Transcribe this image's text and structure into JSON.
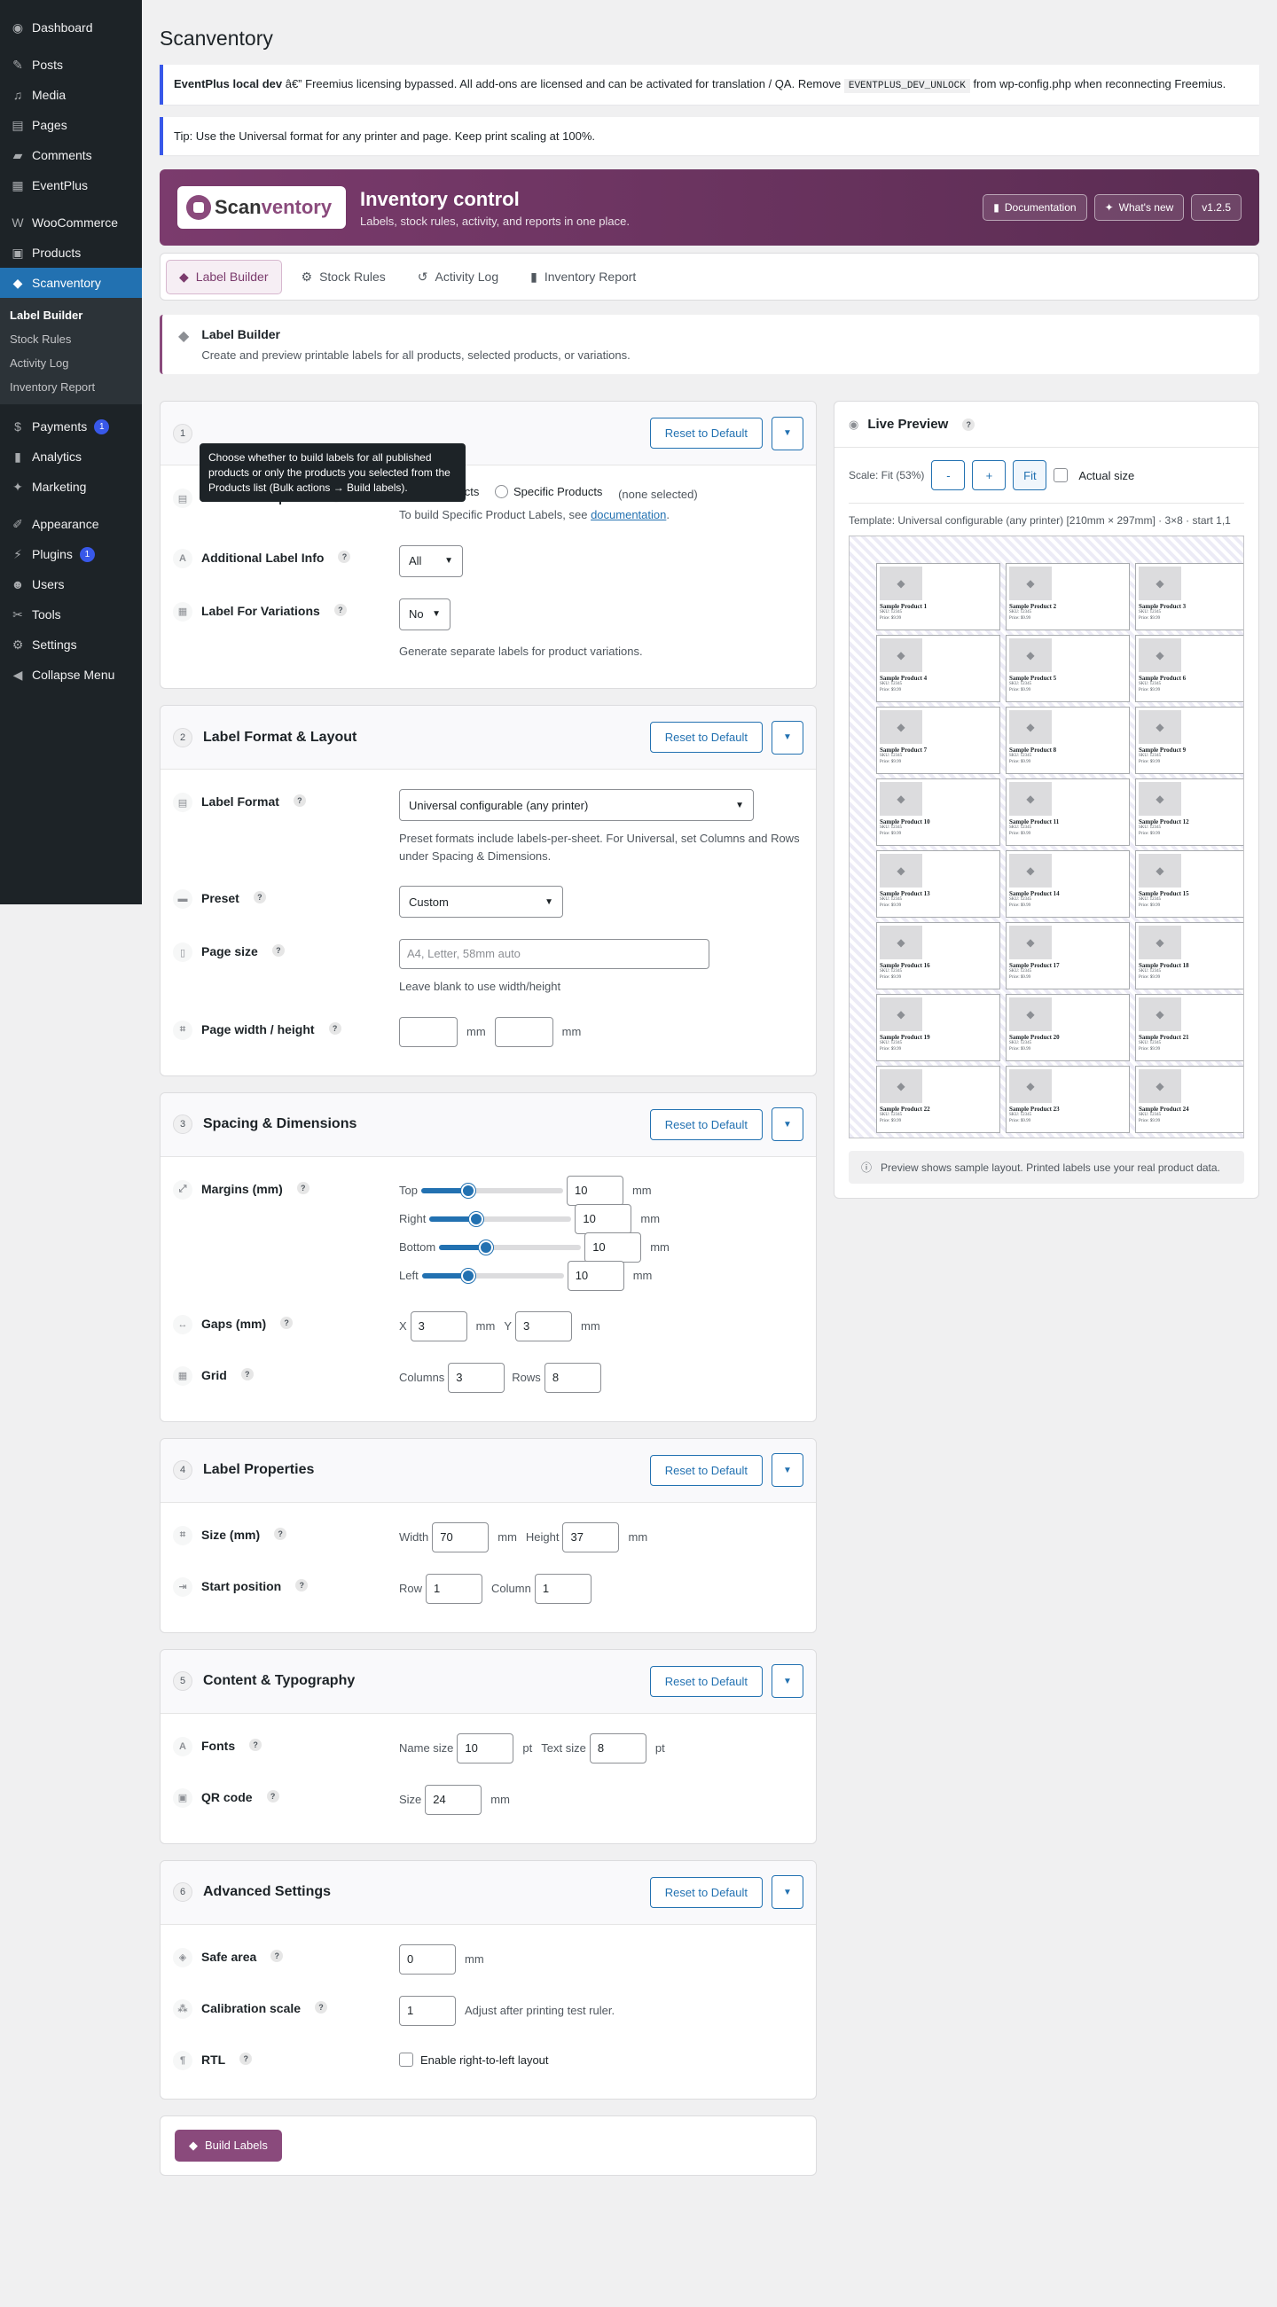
{
  "sidebar": {
    "items": [
      {
        "label": "Dashboard",
        "icon": "dashboard-icon"
      },
      {
        "label": "Posts",
        "icon": "pin-icon"
      },
      {
        "label": "Media",
        "icon": "media-icon"
      },
      {
        "label": "Pages",
        "icon": "pages-icon"
      },
      {
        "label": "Comments",
        "icon": "comment-icon"
      },
      {
        "label": "EventPlus",
        "icon": "calendar-icon"
      },
      {
        "label": "WooCommerce",
        "icon": "woo-icon"
      },
      {
        "label": "Products",
        "icon": "box-icon"
      },
      {
        "label": "Scanventory",
        "icon": "tag-icon"
      },
      {
        "label": "Payments",
        "icon": "dollar-icon",
        "badge": "1"
      },
      {
        "label": "Analytics",
        "icon": "bar-chart-icon"
      },
      {
        "label": "Marketing",
        "icon": "megaphone-icon"
      },
      {
        "label": "Appearance",
        "icon": "brush-icon"
      },
      {
        "label": "Plugins",
        "icon": "plug-icon",
        "badge": "1"
      },
      {
        "label": "Users",
        "icon": "user-icon"
      },
      {
        "label": "Tools",
        "icon": "wrench-icon"
      },
      {
        "label": "Settings",
        "icon": "settings-icon"
      },
      {
        "label": "Collapse Menu",
        "icon": "collapse-icon"
      }
    ],
    "submenu": [
      "Label Builder",
      "Stock Rules",
      "Activity Log",
      "Inventory Report"
    ]
  },
  "page_title": "Scanventory",
  "notice": {
    "strong": "EventPlus local dev",
    "text1": " â€” Freemius licensing bypassed. All add-ons are licensed and can be activated for translation / QA. Remove ",
    "code": "EVENTPLUS_DEV_UNLOCK",
    "text2": " from wp-config.php when reconnecting Freemius."
  },
  "tip": "Tip: Use the Universal format for any printer and page. Keep print scaling at 100%.",
  "banner": {
    "logo_a": "Scan",
    "logo_b": "ventory",
    "title": "Inventory control",
    "subtitle": "Labels, stock rules, activity, and reports in one place.",
    "doc_btn": "Documentation",
    "new_btn": "What's new",
    "version": "v1.2.5"
  },
  "tabs": [
    "Label Builder",
    "Stock Rules",
    "Activity Log",
    "Inventory Report"
  ],
  "intro": {
    "title": "Label Builder",
    "desc": "Create and preview printable labels for all products, selected products, or variations."
  },
  "tooltip": "Choose whether to build labels for all published products or only the products you selected from the Products list (Bulk actions → Build labels).",
  "common": {
    "reset": "Reset to Default",
    "mm": "mm",
    "pt": "pt"
  },
  "sections": {
    "s1": {
      "num": "1",
      "print_options_label": "Label Print Options",
      "radio_all": "All Products",
      "radio_specific": "Specific Products",
      "none_selected": "(none selected)",
      "hint_prefix": "To build Specific Product Labels, see ",
      "hint_link": "documentation",
      "hint_suffix": ".",
      "info_label": "Additional Label Info",
      "info_value": "All",
      "variations_label": "Label For Variations",
      "variations_value": "No",
      "variations_hint": "Generate separate labels for product variations."
    },
    "s2": {
      "num": "2",
      "title": "Label Format & Layout",
      "format_label": "Label Format",
      "format_value": "Universal configurable (any printer)",
      "format_hint": "Preset formats include labels-per-sheet. For Universal, set Columns and Rows under Spacing & Dimensions.",
      "preset_label": "Preset",
      "preset_value": "Custom",
      "page_size_label": "Page size",
      "page_size_placeholder": "A4, Letter, 58mm auto",
      "page_size_hint": "Leave blank to use width/height",
      "page_wh_label": "Page width / height"
    },
    "s3": {
      "num": "3",
      "title": "Spacing & Dimensions",
      "margins_label": "Margins (mm)",
      "margins": [
        {
          "side": "Top",
          "value": "10",
          "level": 0.33
        },
        {
          "side": "Right",
          "value": "10",
          "level": 0.33
        },
        {
          "side": "Bottom",
          "value": "10",
          "level": 0.33
        },
        {
          "side": "Left",
          "value": "10",
          "level": 0.33
        }
      ],
      "gaps_label": "Gaps (mm)",
      "gap_x_lbl": "X",
      "gap_x": "3",
      "gap_y_lbl": "Y",
      "gap_y": "3",
      "grid_label": "Grid",
      "cols_lbl": "Columns",
      "cols": "3",
      "rows_lbl": "Rows",
      "rows": "8"
    },
    "s4": {
      "num": "4",
      "title": "Label Properties",
      "size_label": "Size (mm)",
      "width_lbl": "Width",
      "width": "70",
      "height_lbl": "Height",
      "height": "37",
      "start_label": "Start position",
      "row_lbl": "Row",
      "row": "1",
      "col_lbl": "Column",
      "col": "1"
    },
    "s5": {
      "num": "5",
      "title": "Content & Typography",
      "fonts_label": "Fonts",
      "name_size_lbl": "Name size",
      "name_size": "10",
      "text_size_lbl": "Text size",
      "text_size": "8",
      "qr_label": "QR code",
      "qr_size_lbl": "Size",
      "qr_size": "24"
    },
    "s6": {
      "num": "6",
      "title": "Advanced Settings",
      "safe_label": "Safe area",
      "safe": "0",
      "calib_label": "Calibration scale",
      "calib": "1",
      "calib_hint": "Adjust after printing test ruler.",
      "rtl_label": "RTL",
      "rtl_text": "Enable right-to-left layout"
    }
  },
  "build_btn": "Build Labels",
  "preview": {
    "title": "Live Preview",
    "scale": "Scale: Fit (53%)",
    "minus": "-",
    "plus": "+",
    "fit": "Fit",
    "actual": "Actual size",
    "template": "Template: Universal configurable (any printer) [210mm × 297mm] · 3×8 · start 1,1",
    "labels": [
      "Sample Product 1",
      "Sample Product 2",
      "Sample Product 3",
      "Sample Product 4",
      "Sample Product 5",
      "Sample Product 6",
      "Sample Product 7",
      "Sample Product 8",
      "Sample Product 9",
      "Sample Product 10",
      "Sample Product 11",
      "Sample Product 12",
      "Sample Product 13",
      "Sample Product 14",
      "Sample Product 15",
      "Sample Product 16",
      "Sample Product 17",
      "Sample Product 18",
      "Sample Product 19",
      "Sample Product 20",
      "Sample Product 21",
      "Sample Product 22",
      "Sample Product 23",
      "Sample Product 24"
    ],
    "sku": "SKU: 12345",
    "price": "Price: $9.99",
    "note": "Preview shows sample layout. Printed labels use your real product data."
  },
  "colors": {
    "brand": "#8a4a7c",
    "accent": "#2271b1",
    "sidebar_active": "#2271b1"
  }
}
